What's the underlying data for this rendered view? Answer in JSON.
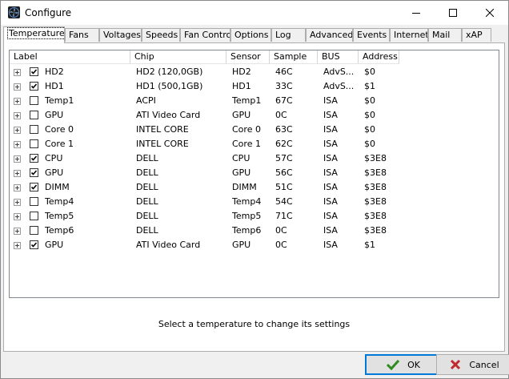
{
  "window": {
    "title": "Configure"
  },
  "tabs": [
    {
      "label": "Temperatures",
      "active": true
    },
    {
      "label": "Fans"
    },
    {
      "label": "Voltages"
    },
    {
      "label": "Speeds"
    },
    {
      "label": "Fan Control"
    },
    {
      "label": "Options"
    },
    {
      "label": "Log"
    },
    {
      "label": "Advanced"
    },
    {
      "label": "Events"
    },
    {
      "label": "Internet"
    },
    {
      "label": "Mail"
    },
    {
      "label": "xAP"
    }
  ],
  "columns": [
    "Label",
    "Chip",
    "Sensor",
    "Sample",
    "BUS",
    "Address"
  ],
  "rows": [
    {
      "checked": true,
      "label": "HD2",
      "chip": "HD2 (120,0GB)",
      "sensor": "HD2",
      "sample": "46C",
      "bus": "AdvS...",
      "address": "$0"
    },
    {
      "checked": true,
      "label": "HD1",
      "chip": "HD1 (500,1GB)",
      "sensor": "HD1",
      "sample": "33C",
      "bus": "AdvS...",
      "address": "$1"
    },
    {
      "checked": false,
      "label": "Temp1",
      "chip": "ACPI",
      "sensor": "Temp1",
      "sample": "67C",
      "bus": "ISA",
      "address": "$0"
    },
    {
      "checked": false,
      "label": "GPU",
      "chip": "ATI Video Card",
      "sensor": "GPU",
      "sample": "0C",
      "bus": "ISA",
      "address": "$0"
    },
    {
      "checked": false,
      "label": "Core 0",
      "chip": "INTEL CORE",
      "sensor": "Core 0",
      "sample": "63C",
      "bus": "ISA",
      "address": "$0"
    },
    {
      "checked": false,
      "label": "Core 1",
      "chip": "INTEL CORE",
      "sensor": "Core 1",
      "sample": "62C",
      "bus": "ISA",
      "address": "$0"
    },
    {
      "checked": true,
      "label": "CPU",
      "chip": "DELL",
      "sensor": "CPU",
      "sample": "57C",
      "bus": "ISA",
      "address": "$3E8"
    },
    {
      "checked": true,
      "label": "GPU",
      "chip": "DELL",
      "sensor": "GPU",
      "sample": "56C",
      "bus": "ISA",
      "address": "$3E8"
    },
    {
      "checked": true,
      "label": "DIMM",
      "chip": "DELL",
      "sensor": "DIMM",
      "sample": "51C",
      "bus": "ISA",
      "address": "$3E8"
    },
    {
      "checked": false,
      "label": "Temp4",
      "chip": "DELL",
      "sensor": "Temp4",
      "sample": "54C",
      "bus": "ISA",
      "address": "$3E8"
    },
    {
      "checked": false,
      "label": "Temp5",
      "chip": "DELL",
      "sensor": "Temp5",
      "sample": "71C",
      "bus": "ISA",
      "address": "$3E8"
    },
    {
      "checked": false,
      "label": "Temp6",
      "chip": "DELL",
      "sensor": "Temp6",
      "sample": "0C",
      "bus": "ISA",
      "address": "$3E8"
    },
    {
      "checked": true,
      "label": "GPU",
      "chip": "ATI Video Card",
      "sensor": "GPU",
      "sample": "0C",
      "bus": "ISA",
      "address": "$1"
    }
  ],
  "status_text": "Select a temperature to change its settings",
  "buttons": {
    "ok": "OK",
    "cancel": "Cancel"
  },
  "colors": {
    "ok_check": "#2e8b1e",
    "cancel_x": "#c0282d",
    "focus_border": "#0078d7"
  }
}
